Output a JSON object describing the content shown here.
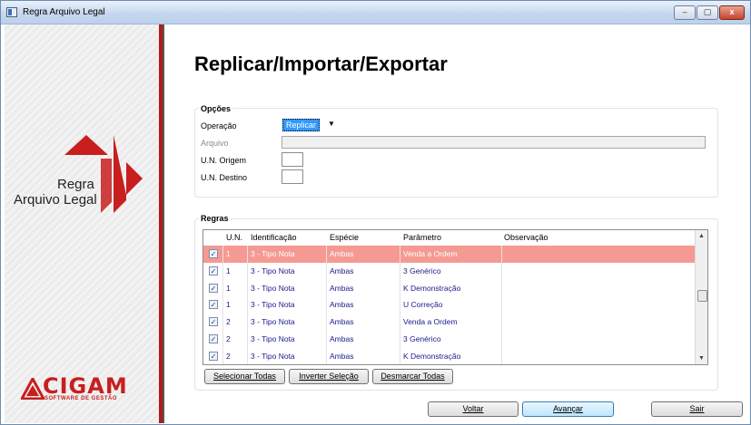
{
  "window": {
    "title": "Regra Arquivo Legal",
    "min_label": "–",
    "max_label": "▢",
    "close_label": "x"
  },
  "left_panel": {
    "logo_line1": "Regra",
    "logo_line2": "Arquivo Legal",
    "brand": "CIGAM",
    "brand_sub": "SOFTWARE DE GESTÃO"
  },
  "page_title": "Replicar/Importar/Exportar",
  "opcoes": {
    "title": "Opções",
    "operacao_label": "Operação",
    "operacao_value": "Replicar",
    "arquivo_label": "Arquivo",
    "arquivo_value": "",
    "un_origem_label": "U.N. Origem",
    "un_origem_value": "",
    "un_destino_label": "U.N. Destino",
    "un_destino_value": ""
  },
  "regras": {
    "title": "Regras",
    "columns": [
      "U.N.",
      "Identificação",
      "Espécie",
      "Parâmetro",
      "Observação"
    ],
    "rows": [
      {
        "checked": true,
        "un": "1",
        "identificacao": "3 - Tipo Nota",
        "especie": "Ambas",
        "parametro": "Venda a Ordem",
        "observacao": ""
      },
      {
        "checked": true,
        "un": "1",
        "identificacao": "3 - Tipo Nota",
        "especie": "Ambas",
        "parametro": "3 Genérico",
        "observacao": ""
      },
      {
        "checked": true,
        "un": "1",
        "identificacao": "3 - Tipo Nota",
        "especie": "Ambas",
        "parametro": "K Demonstração",
        "observacao": ""
      },
      {
        "checked": true,
        "un": "1",
        "identificacao": "3 - Tipo Nota",
        "especie": "Ambas",
        "parametro": "U Correção",
        "observacao": ""
      },
      {
        "checked": true,
        "un": "2",
        "identificacao": "3 - Tipo Nota",
        "especie": "Ambas",
        "parametro": "Venda a Ordem",
        "observacao": ""
      },
      {
        "checked": true,
        "un": "2",
        "identificacao": "3 - Tipo Nota",
        "especie": "Ambas",
        "parametro": "3 Genérico",
        "observacao": ""
      },
      {
        "checked": true,
        "un": "2",
        "identificacao": "3 - Tipo Nota",
        "especie": "Ambas",
        "parametro": "K Demonstração",
        "observacao": ""
      }
    ],
    "selected_row": 0,
    "selected_color": "#f59a93"
  },
  "buttons": {
    "selecionar_todas": "Selecionar Todas",
    "inverter_selecao": "Inverter Seleção",
    "desmarcar_todas": "Desmarcar Todas",
    "voltar": "Voltar",
    "avancar": "Avançar",
    "sair": "Sair"
  },
  "colors": {
    "brand_red": "#c81e1e",
    "selection_blue": "#3399ff"
  }
}
